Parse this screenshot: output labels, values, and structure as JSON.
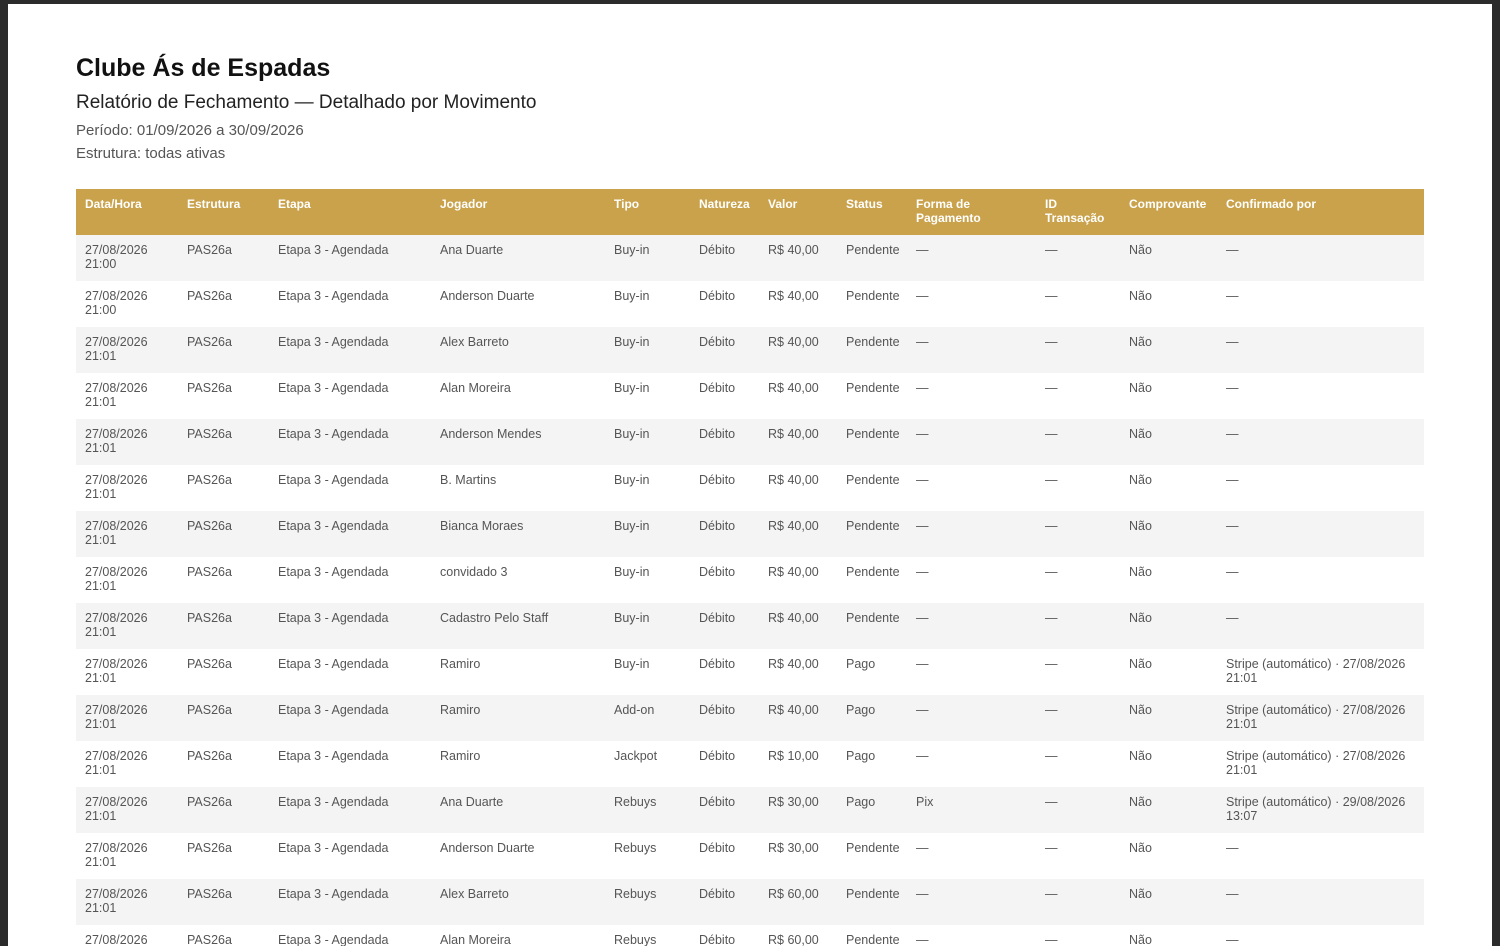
{
  "report": {
    "title": "Clube Ás de Espadas",
    "subtitle": "Relatório de Fechamento — Detalhado por Movimento",
    "period": "Período: 01/09/2026 a 30/09/2026",
    "structure": "Estrutura: todas ativas"
  },
  "table": {
    "columns": [
      "Data/Hora",
      "Estrutura",
      "Etapa",
      "Jogador",
      "Tipo",
      "Natureza",
      "Valor",
      "Status",
      "Forma de Pagamento",
      "ID Transação",
      "Comprovante",
      "Confirmado por"
    ],
    "rows": [
      [
        "27/08/2026 21:00",
        "PAS26a",
        "Etapa 3 - Agendada",
        "Ana Duarte",
        "Buy-in",
        "Débito",
        "R$ 40,00",
        "Pendente",
        "—",
        "—",
        "Não",
        "—"
      ],
      [
        "27/08/2026 21:00",
        "PAS26a",
        "Etapa 3 - Agendada",
        "Anderson Duarte",
        "Buy-in",
        "Débito",
        "R$ 40,00",
        "Pendente",
        "—",
        "—",
        "Não",
        "—"
      ],
      [
        "27/08/2026 21:01",
        "PAS26a",
        "Etapa 3 - Agendada",
        "Alex Barreto",
        "Buy-in",
        "Débito",
        "R$ 40,00",
        "Pendente",
        "—",
        "—",
        "Não",
        "—"
      ],
      [
        "27/08/2026 21:01",
        "PAS26a",
        "Etapa 3 - Agendada",
        "Alan Moreira",
        "Buy-in",
        "Débito",
        "R$ 40,00",
        "Pendente",
        "—",
        "—",
        "Não",
        "—"
      ],
      [
        "27/08/2026 21:01",
        "PAS26a",
        "Etapa 3 - Agendada",
        "Anderson Mendes",
        "Buy-in",
        "Débito",
        "R$ 40,00",
        "Pendente",
        "—",
        "—",
        "Não",
        "—"
      ],
      [
        "27/08/2026 21:01",
        "PAS26a",
        "Etapa 3 - Agendada",
        "B. Martins",
        "Buy-in",
        "Débito",
        "R$ 40,00",
        "Pendente",
        "—",
        "—",
        "Não",
        "—"
      ],
      [
        "27/08/2026 21:01",
        "PAS26a",
        "Etapa 3 - Agendada",
        "Bianca Moraes",
        "Buy-in",
        "Débito",
        "R$ 40,00",
        "Pendente",
        "—",
        "—",
        "Não",
        "—"
      ],
      [
        "27/08/2026 21:01",
        "PAS26a",
        "Etapa 3 - Agendada",
        "convidado 3",
        "Buy-in",
        "Débito",
        "R$ 40,00",
        "Pendente",
        "—",
        "—",
        "Não",
        "—"
      ],
      [
        "27/08/2026 21:01",
        "PAS26a",
        "Etapa 3 - Agendada",
        "Cadastro Pelo Staff",
        "Buy-in",
        "Débito",
        "R$ 40,00",
        "Pendente",
        "—",
        "—",
        "Não",
        "—"
      ],
      [
        "27/08/2026 21:01",
        "PAS26a",
        "Etapa 3 - Agendada",
        "Ramiro",
        "Buy-in",
        "Débito",
        "R$ 40,00",
        "Pago",
        "—",
        "—",
        "Não",
        "Stripe (automático) · 27/08/2026 21:01"
      ],
      [
        "27/08/2026 21:01",
        "PAS26a",
        "Etapa 3 - Agendada",
        "Ramiro",
        "Add-on",
        "Débito",
        "R$ 40,00",
        "Pago",
        "—",
        "—",
        "Não",
        "Stripe (automático) · 27/08/2026 21:01"
      ],
      [
        "27/08/2026 21:01",
        "PAS26a",
        "Etapa 3 - Agendada",
        "Ramiro",
        "Jackpot",
        "Débito",
        "R$ 10,00",
        "Pago",
        "—",
        "—",
        "Não",
        "Stripe (automático) · 27/08/2026 21:01"
      ],
      [
        "27/08/2026 21:01",
        "PAS26a",
        "Etapa 3 - Agendada",
        "Ana Duarte",
        "Rebuys",
        "Débito",
        "R$ 30,00",
        "Pago",
        "Pix",
        "—",
        "Não",
        "Stripe (automático) · 29/08/2026 13:07"
      ],
      [
        "27/08/2026 21:01",
        "PAS26a",
        "Etapa 3 - Agendada",
        "Anderson Duarte",
        "Rebuys",
        "Débito",
        "R$ 30,00",
        "Pendente",
        "—",
        "—",
        "Não",
        "—"
      ],
      [
        "27/08/2026 21:01",
        "PAS26a",
        "Etapa 3 - Agendada",
        "Alex Barreto",
        "Rebuys",
        "Débito",
        "R$ 60,00",
        "Pendente",
        "—",
        "—",
        "Não",
        "—"
      ],
      [
        "27/08/2026",
        "PAS26a",
        "Etapa 3 - Agendada",
        "Alan Moreira",
        "Rebuys",
        "Débito",
        "R$ 60,00",
        "Pendente",
        "—",
        "—",
        "Não",
        "—"
      ]
    ]
  }
}
